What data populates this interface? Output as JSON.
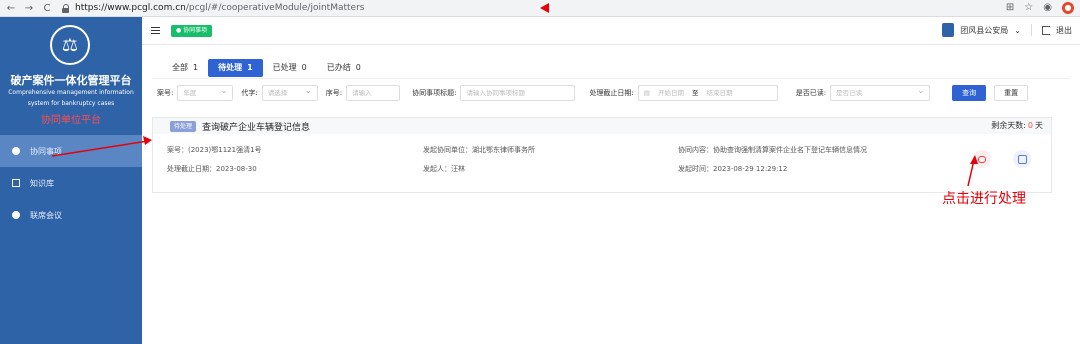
{
  "browser": {
    "nav": [
      "←",
      "→",
      "C"
    ],
    "url_host": "https://www.pcgl.com.cn",
    "url_path": "/pcgl/#/cooperativeModule/jointMatters"
  },
  "sidebar": {
    "logo_glyph": "⚖",
    "title_cn": "破产案件一体化管理平台",
    "title_en_1": "Comprehensive management information",
    "title_en_2": "system for bankruptcy cases",
    "subtitle": "协同单位平台",
    "items": [
      {
        "label": "协同事项",
        "icon": "dot-icon",
        "active": true
      },
      {
        "label": "知识库",
        "icon": "book-icon",
        "active": false
      },
      {
        "label": "联席会议",
        "icon": "dot-icon",
        "active": false
      }
    ]
  },
  "header": {
    "tag": "● 协同事项",
    "user": "团风县公安局",
    "dropdown": "⌄",
    "logout": "退出"
  },
  "tabs": [
    {
      "label": "全部",
      "count": "1",
      "active": false
    },
    {
      "label": "待处理",
      "count": "1",
      "active": true
    },
    {
      "label": "已处理",
      "count": "0",
      "active": false
    },
    {
      "label": "已办结",
      "count": "0",
      "active": false
    }
  ],
  "filters": {
    "case_no_label": "案号:",
    "year_placeholder": "年度",
    "code_label": "代字:",
    "code_placeholder": "请选择",
    "seq_label": "序号:",
    "seq_placeholder": "请输入",
    "title_label": "协同事项标题:",
    "title_placeholder": "请输入协同事项标题",
    "deadline_label": "处理截止日期:",
    "start_placeholder": "开始日期",
    "to": "至",
    "end_placeholder": "结束日期",
    "read_label": "是否已读:",
    "read_placeholder": "是否已读",
    "query": "查询",
    "reset": "重置"
  },
  "card": {
    "status_tag": "待处理",
    "title": "查询破产企业车辆登记信息",
    "remain_label": "剩余天数:",
    "remain_days": "0",
    "remain_unit": "天",
    "case_no": "案号：(2023)鄂1121强清1号",
    "initiator_unit": "发起协同单位：湖北鄂东律师事务所",
    "content": "协同内容：协助查询强制清算案件企业名下登记车辆信息情况",
    "deadline": "处理截止日期：2023-08-30",
    "initiator": "发起人：汪林",
    "sent_time": "发起时间：2023-08-29 12:29:12"
  },
  "annotation": {
    "text": "点击进行处理",
    "color": "#e8000b"
  }
}
